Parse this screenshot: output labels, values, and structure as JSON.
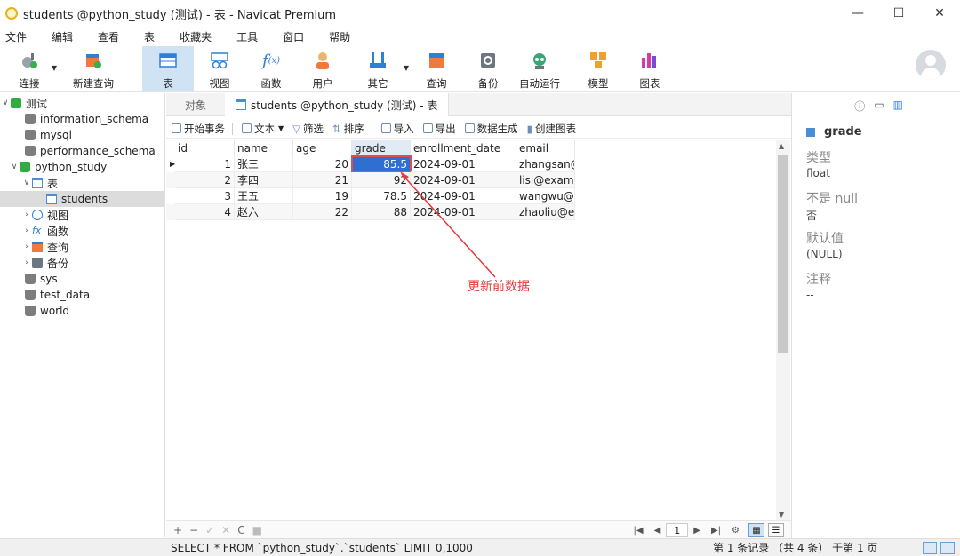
{
  "window": {
    "title": "students @python_study (测试) - 表 - Navicat Premium",
    "controls": [
      "—",
      "☐",
      "✕"
    ]
  },
  "menu": [
    "文件",
    "编辑",
    "查看",
    "表",
    "收藏夹",
    "工具",
    "窗口",
    "帮助"
  ],
  "toolbar": [
    {
      "label": "连接",
      "icon": "plug-icon",
      "dropdown": true
    },
    {
      "label": "新建查询",
      "icon": "new-query-icon"
    },
    {
      "label": "表",
      "icon": "table-icon",
      "active": true
    },
    {
      "label": "视图",
      "icon": "view-icon"
    },
    {
      "label": "函数",
      "icon": "function-icon"
    },
    {
      "label": "用户",
      "icon": "user-icon"
    },
    {
      "label": "其它",
      "icon": "tools-icon",
      "dropdown": true
    },
    {
      "label": "查询",
      "icon": "query-icon"
    },
    {
      "label": "备份",
      "icon": "backup-icon"
    },
    {
      "label": "自动运行",
      "icon": "robot-icon"
    },
    {
      "label": "模型",
      "icon": "model-icon"
    },
    {
      "label": "图表",
      "icon": "chart-icon"
    }
  ],
  "tree": {
    "connection": "测试",
    "items": [
      "information_schema",
      "mysql",
      "performance_schema",
      "python_study"
    ],
    "python_study_children": {
      "tables_label": "表",
      "table": "students",
      "views": "视图",
      "functions": "函数",
      "queries": "查询",
      "backups": "备份"
    },
    "more_dbs": [
      "sys",
      "test_data",
      "world"
    ]
  },
  "tabs": {
    "objects": "对象",
    "active": "students @python_study (测试) - 表"
  },
  "subtoolbar": {
    "begin_tx": "开始事务",
    "text": "文本",
    "filter": "筛选",
    "sort": "排序",
    "import": "导入",
    "export": "导出",
    "data_gen": "数据生成",
    "create_chart": "创建图表"
  },
  "grid": {
    "columns": [
      "id",
      "name",
      "age",
      "grade",
      "enrollment_date",
      "email"
    ],
    "rows": [
      [
        "1",
        "张三",
        "20",
        "85.5",
        "2024-09-01",
        "zhangsan@e"
      ],
      [
        "2",
        "李四",
        "21",
        "92",
        "2024-09-01",
        "lisi@examp"
      ],
      [
        "3",
        "王五",
        "19",
        "78.5",
        "2024-09-01",
        "wangwu@e"
      ],
      [
        "4",
        "赵六",
        "22",
        "88",
        "2024-09-01",
        "zhaoliu@ex"
      ]
    ]
  },
  "annotation": {
    "text": "更新前数据",
    "color": "#e23b3b"
  },
  "bottombar": {
    "actions": [
      "+",
      "−",
      "✓",
      "✕",
      "C",
      "■"
    ],
    "page": "1"
  },
  "status": {
    "sql": "SELECT * FROM `python_study`.`students` LIMIT 0,1000",
    "records": "第 1 条记录 （共 4 条） 于第 1 页"
  },
  "rightpanel": {
    "field": "grade",
    "type_label": "类型",
    "type_value": "float",
    "notnull_label": "不是 null",
    "notnull_value": "否",
    "default_label": "默认值",
    "default_value": "(NULL)",
    "comment_label": "注释",
    "comment_value": "--"
  }
}
